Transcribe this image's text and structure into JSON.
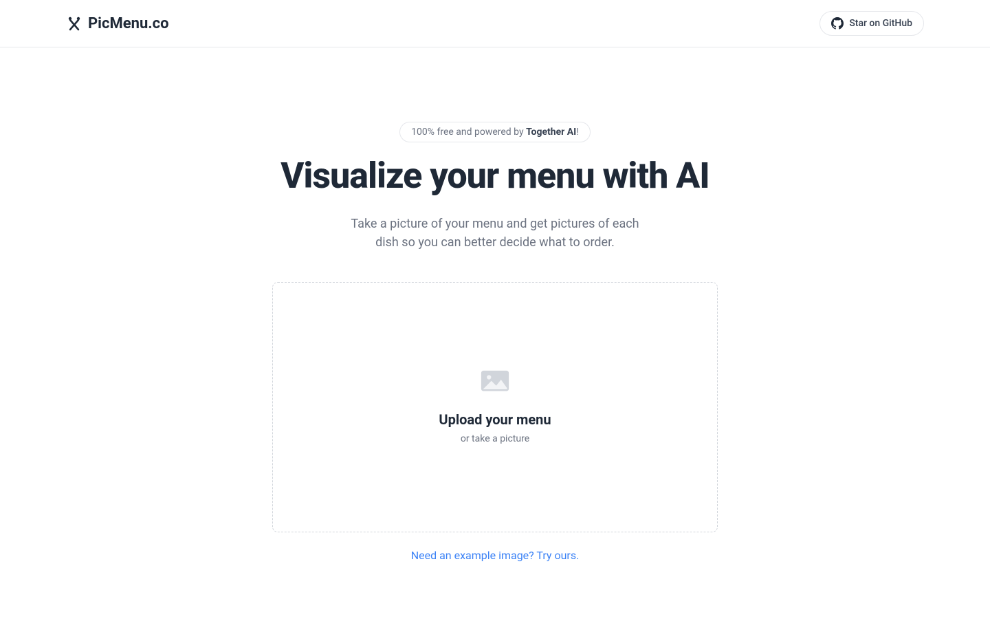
{
  "header": {
    "logo_text": "PicMenu.co",
    "github_label": "Star on GitHub"
  },
  "hero": {
    "badge_prefix": "100% free and powered by ",
    "badge_bold": "Together AI",
    "badge_suffix": "!",
    "title": "Visualize your menu with AI",
    "subtitle": "Take a picture of your menu and get pictures of each dish so you can better decide what to order."
  },
  "upload": {
    "title": "Upload your menu",
    "subtitle": "or take a picture"
  },
  "example_link": "Need an example image? Try ours."
}
